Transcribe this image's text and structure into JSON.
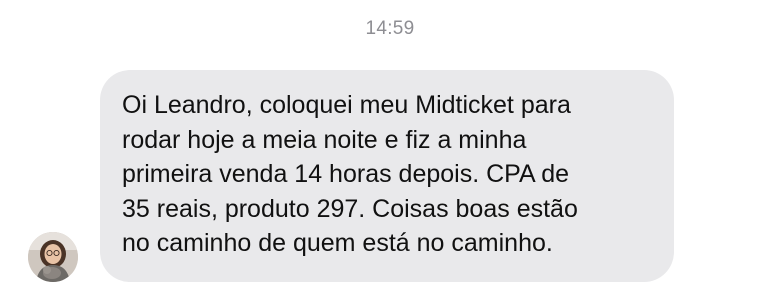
{
  "chat": {
    "timestamp": "14:59",
    "message": {
      "text": "Oi Leandro, coloquei meu Midticket para\nrodar hoje a meia noite e fiz a minha\nprimeira venda 14 horas depois. CPA de\n35 reais, produto 297. Coisas boas estão\nno caminho de quem está no caminho.",
      "bubble_color": "#e9e9eb",
      "text_color": "#111111"
    },
    "sender": {
      "avatar_icon": "user-avatar-photo"
    }
  },
  "colors": {
    "timestamp": "#8e8e93",
    "background": "#ffffff"
  }
}
